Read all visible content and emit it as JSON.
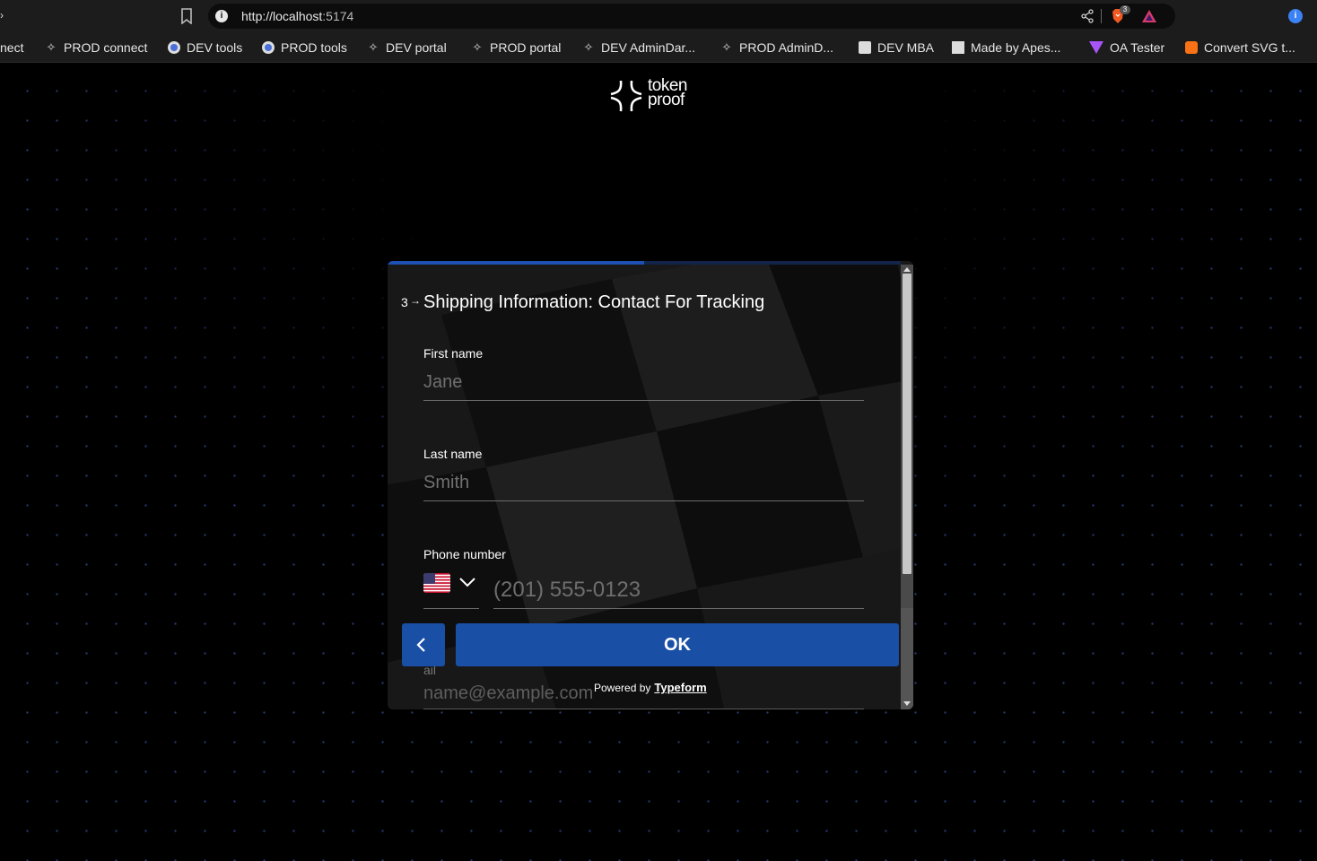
{
  "browser": {
    "back_fragment": "›",
    "url": {
      "scheme_host": "http://localhost",
      "port": ":5174"
    },
    "brave_badge": "3",
    "bookmarks": [
      {
        "label": "nect",
        "icon": "none"
      },
      {
        "label": "PROD connect",
        "icon": "spark-icon"
      },
      {
        "label": "DEV tools",
        "icon": "globe-icon"
      },
      {
        "label": "PROD tools",
        "icon": "globe-icon"
      },
      {
        "label": "DEV portal",
        "icon": "spark-icon"
      },
      {
        "label": "PROD portal",
        "icon": "spark-icon"
      },
      {
        "label": "DEV AdminDar...",
        "icon": "spark-icon"
      },
      {
        "label": "PROD AdminD...",
        "icon": "spark-icon"
      },
      {
        "label": "DEV MBA",
        "icon": "mba-icon"
      },
      {
        "label": "Made by Apes...",
        "icon": "made-icon"
      },
      {
        "label": "OA Tester",
        "icon": "oa-icon"
      },
      {
        "label": "Convert SVG t...",
        "icon": "svg-convert-icon"
      }
    ],
    "extension_icon": "i"
  },
  "logo": {
    "line1": "token",
    "line2": "proof"
  },
  "form": {
    "progress": 0.5,
    "question_number": "3",
    "question_arrow": "→",
    "title": "Shipping Information: Contact For Tracking",
    "first_name": {
      "label": "First name",
      "placeholder": "Jane"
    },
    "last_name": {
      "label": "Last name",
      "placeholder": "Smith"
    },
    "phone": {
      "label": "Phone number",
      "country": "US",
      "placeholder": "(201) 555-0123"
    },
    "email": {
      "label_fragment": "ail",
      "placeholder": "name@example.com"
    },
    "ok_label": "OK",
    "powered_by": "Powered by",
    "powered_brand": "Typeform"
  },
  "colors": {
    "accent": "#1a4fa6",
    "progress_track": "#12244a",
    "background": "#000000",
    "grid_dots": "#4664c8"
  }
}
